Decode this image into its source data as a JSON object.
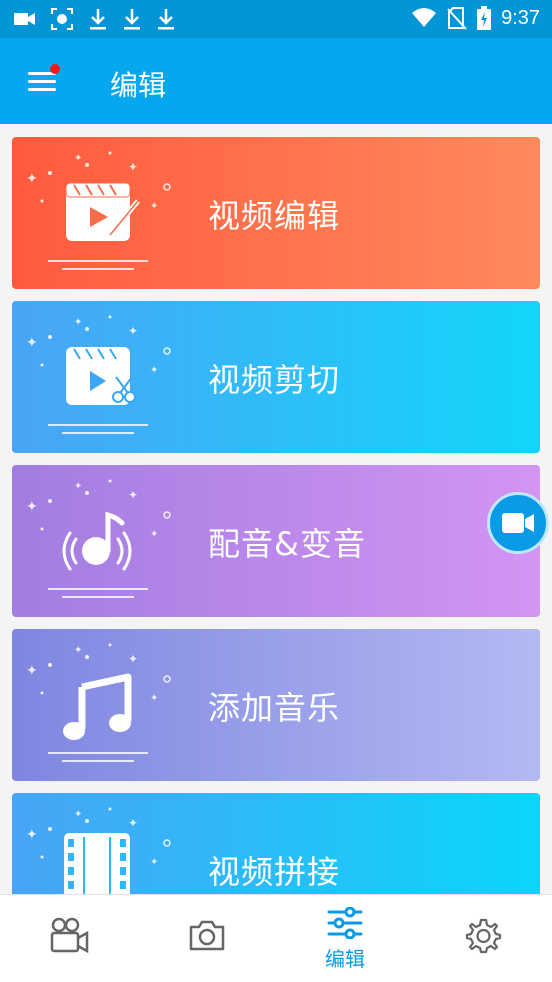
{
  "status_bar": {
    "time": "9:37",
    "left_icons": [
      "video-icon",
      "screenshot-icon",
      "download-icon",
      "download-icon",
      "download-icon"
    ],
    "right_icons": [
      "wifi-icon",
      "no-sim-icon",
      "battery-charging-icon"
    ]
  },
  "app_bar": {
    "title": "编辑",
    "menu_icon": "menu-icon",
    "notification_dot_color": "#f21b1b",
    "background": "#05a7ef"
  },
  "cards": [
    {
      "label": "视频编辑",
      "icon": "video-edit-icon",
      "colors": [
        "#ff5a3d",
        "#ff8a5c"
      ]
    },
    {
      "label": "视频剪切",
      "icon": "video-cut-icon",
      "colors": [
        "#4aa4f6",
        "#12d6fb"
      ]
    },
    {
      "label": "配音&变音",
      "icon": "voice-change-icon",
      "colors": [
        "#a17de0",
        "#d494f4"
      ]
    },
    {
      "label": "添加音乐",
      "icon": "music-note-icon",
      "colors": [
        "#7f86e1",
        "#b3b9f2"
      ]
    },
    {
      "label": "视频拼接",
      "icon": "film-strip-icon",
      "colors": [
        "#48a4f6",
        "#0ad6fb"
      ]
    }
  ],
  "floating_button": {
    "icon": "video-camera-icon"
  },
  "bottom_nav": {
    "items": [
      {
        "icon": "movie-camera-icon",
        "label": ""
      },
      {
        "icon": "camera-icon",
        "label": ""
      },
      {
        "icon": "sliders-icon",
        "label": "编辑",
        "active": true
      },
      {
        "icon": "settings-gear-icon",
        "label": ""
      }
    ],
    "active_color": "#0a9ae6",
    "inactive_color": "#666666"
  }
}
